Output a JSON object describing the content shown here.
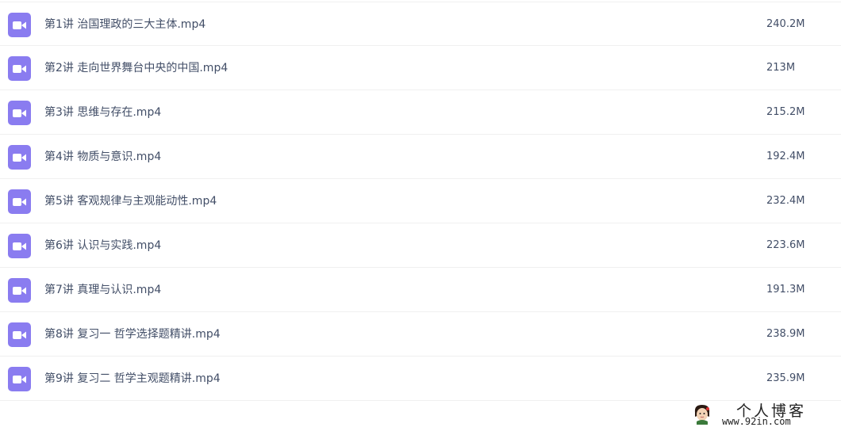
{
  "files": [
    {
      "name": "第1讲 治国理政的三大主体.mp4",
      "size": "240.2M",
      "icon": "video-file-icon"
    },
    {
      "name": "第2讲 走向世界舞台中央的中国.mp4",
      "size": "213M",
      "icon": "video-file-icon"
    },
    {
      "name": "第3讲 思维与存在.mp4",
      "size": "215.2M",
      "icon": "video-file-icon"
    },
    {
      "name": "第4讲 物质与意识.mp4",
      "size": "192.4M",
      "icon": "video-file-icon"
    },
    {
      "name": "第5讲 客观规律与主观能动性.mp4",
      "size": "232.4M",
      "icon": "video-file-icon"
    },
    {
      "name": "第6讲 认识与实践.mp4",
      "size": "223.6M",
      "icon": "video-file-icon"
    },
    {
      "name": "第7讲 真理与认识.mp4",
      "size": "191.3M",
      "icon": "video-file-icon"
    },
    {
      "name": "第8讲 复习一 哲学选择题精讲.mp4",
      "size": "238.9M",
      "icon": "video-file-icon"
    },
    {
      "name": "第9讲 复习二 哲学主观题精讲.mp4",
      "size": "235.9M",
      "icon": "video-file-icon"
    }
  ],
  "watermark": {
    "title": "个人博客",
    "url": "www.92in.com",
    "icon": "avatar-icon"
  },
  "colors": {
    "icon_purple": "#8a7cf0",
    "text": "#424e67",
    "divider": "#f0f0f0"
  }
}
